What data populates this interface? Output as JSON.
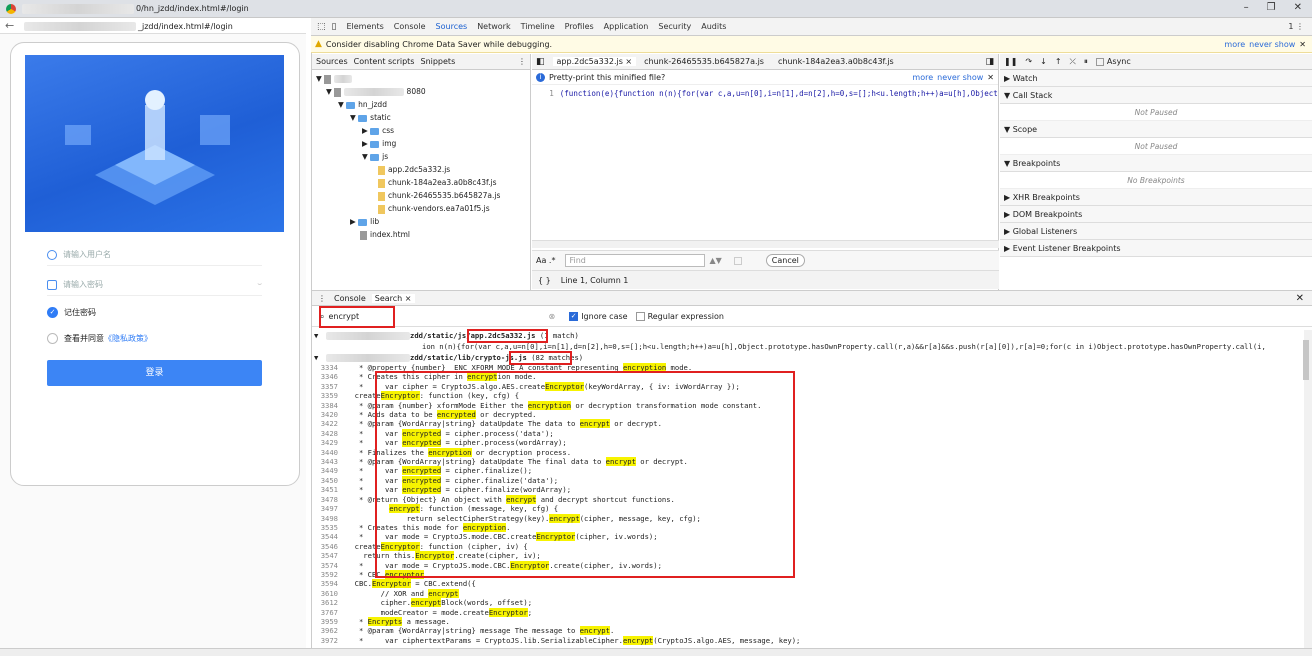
{
  "browser": {
    "title_url": "0/hn_jzdd/index.html#/login",
    "address": "_jzdd/index.html#/login",
    "window_controls": [
      "–",
      "❐",
      "✕"
    ]
  },
  "login_page": {
    "username_placeholder": "请输入用户名",
    "password_placeholder": "请输入密码",
    "remember_label": "记住密码",
    "agree_prefix": "查看并同意",
    "policy_link": "《隐私政策》",
    "login_button": "登录"
  },
  "devtools": {
    "tabs": [
      "Elements",
      "Console",
      "Sources",
      "Network",
      "Timeline",
      "Profiles",
      "Application",
      "Security",
      "Audits"
    ],
    "active_tab": "Sources",
    "warning": "Consider disabling Chrome Data Saver while debugging.",
    "warning_more": "more",
    "warning_never": "never show",
    "nav_tabs": [
      "Sources",
      "Content scripts",
      "Snippets"
    ],
    "tree": {
      "root": "top",
      "host": "8080",
      "project": "hn_jzdd",
      "static": "static",
      "css": "css",
      "img": "img",
      "js": "js",
      "files": [
        "app.2dc5a332.js",
        "chunk-184a2ea3.a0b8c43f.js",
        "chunk-26465535.b645827a.js",
        "chunk-vendors.ea7a01f5.js"
      ],
      "lib": "lib",
      "index": "index.html"
    },
    "editor_tabs": [
      "app.2dc5a332.js ×",
      "chunk-26465535.b645827a.js",
      "chunk-184a2ea3.a0b8c43f.js"
    ],
    "pretty_print": "Pretty-print this minified file?",
    "pretty_more": "more",
    "pretty_never": "never show",
    "code_line_no": "1",
    "code_line": "(function(e){function n(n){for(var c,a,u=n[0],i=n[1],d=n[2],h=0,s=[];h<u.length;h++)a=u[h],Object.",
    "find_placeholder": "Find",
    "cancel": "Cancel",
    "cursor_pos": "Line 1, Column 1",
    "debugger_async": "Async",
    "sections": {
      "watch": "Watch",
      "callstack": "Call Stack",
      "not_paused": "Not Paused",
      "scope": "Scope",
      "not_paused2": "Not Paused",
      "breakpoints": "Breakpoints",
      "no_breakpoints": "No Breakpoints",
      "xhr": "XHR Breakpoints",
      "dom": "DOM Breakpoints",
      "global": "Global Listeners",
      "event": "Event Listener Breakpoints"
    },
    "drawer_tabs": [
      "Console",
      "Search ×"
    ],
    "search_value": "encrypt",
    "ignore_case": "Ignore case",
    "regex": "Regular expression",
    "result1_path": "zdd/static/js/",
    "result1_file": "app.2dc5a332.js",
    "result1_count": "(1 match)",
    "result1_line": "ion n(n){for(var c,a,u=n[0],i=n[1],d=n[2],h=0,s=[];h<u.length;h++)a=u[h],Object.prototype.hasOwnProperty.call(r,a)&&r[a]&&s.push(r[a][0]),r[a]=0;for(c in i)Object.prototype.hasOwnProperty.call(i,",
    "result2_path": "zdd/static/lib/",
    "result2_file": "crypto-js.js",
    "result2_count": "(82 matches)",
    "results": [
      {
        "ln": "3334",
        "pre": "   * @property {number} _ENC_XFORM_MODE A constant representing ",
        "hl": "encryption",
        "post": " mode."
      },
      {
        "ln": "3346",
        "pre": "   * Creates this cipher in ",
        "hl": "encrypt",
        "post": "ion mode."
      },
      {
        "ln": "3357",
        "pre": "   *     var cipher = CryptoJS.algo.AES.create",
        "hl": "Encryptor",
        "post": "(keyWordArray, { iv: ivWordArray });"
      },
      {
        "ln": "3359",
        "pre": "  create",
        "hl": "Encryptor",
        "post": ": function (key, cfg) {"
      },
      {
        "ln": "3384",
        "pre": "   * @param {number} xformMode Either the ",
        "hl": "encryption",
        "post": " or decryption transformation mode constant."
      },
      {
        "ln": "3420",
        "pre": "   * Adds data to be ",
        "hl": "encrypted",
        "post": " or decrypted."
      },
      {
        "ln": "3422",
        "pre": "   * @param {WordArray|string} dataUpdate The data to ",
        "hl": "encrypt",
        "post": " or decrypt."
      },
      {
        "ln": "3428",
        "pre": "   *     var ",
        "hl": "encrypted",
        "post": " = cipher.process('data');"
      },
      {
        "ln": "3429",
        "pre": "   *     var ",
        "hl": "encrypted",
        "post": " = cipher.process(wordArray);"
      },
      {
        "ln": "3440",
        "pre": "   * Finalizes the ",
        "hl": "encryption",
        "post": " or decryption process."
      },
      {
        "ln": "3443",
        "pre": "   * @param {WordArray|string} dataUpdate The final data to ",
        "hl": "encrypt",
        "post": " or decrypt."
      },
      {
        "ln": "3449",
        "pre": "   *     var ",
        "hl": "encrypted",
        "post": " = cipher.finalize();"
      },
      {
        "ln": "3450",
        "pre": "   *     var ",
        "hl": "encrypted",
        "post": " = cipher.finalize('data');"
      },
      {
        "ln": "3451",
        "pre": "   *     var ",
        "hl": "encrypted",
        "post": " = cipher.finalize(wordArray);"
      },
      {
        "ln": "3478",
        "pre": "   * @return {Object} An object with ",
        "hl": "encrypt",
        "post": " and decrypt shortcut functions."
      },
      {
        "ln": "3497",
        "pre": "          ",
        "hl": "encrypt",
        "post": ": function (message, key, cfg) {"
      },
      {
        "ln": "3498",
        "pre": "              return selectCipherStrategy(key).",
        "hl": "encrypt",
        "post": "(cipher, message, key, cfg);"
      },
      {
        "ln": "3535",
        "pre": "   * Creates this mode for ",
        "hl": "encryption",
        "post": "."
      },
      {
        "ln": "3544",
        "pre": "   *     var mode = CryptoJS.mode.CBC.create",
        "hl": "Encryptor",
        "post": "(cipher, iv.words);"
      },
      {
        "ln": "3546",
        "pre": "  create",
        "hl": "Encryptor",
        "post": ": function (cipher, iv) {"
      },
      {
        "ln": "3547",
        "pre": "    return this.",
        "hl": "Encryptor",
        "post": ".create(cipher, iv);"
      },
      {
        "ln": "3574",
        "pre": "   *     var mode = CryptoJS.mode.CBC.",
        "hl": "Encryptor",
        "post": ".create(cipher, iv.words);"
      },
      {
        "ln": "3592",
        "pre": "   * CBC ",
        "hl": "encryptor",
        "post": "."
      },
      {
        "ln": "3594",
        "pre": "  CBC.",
        "hl": "Encryptor",
        "post": " = CBC.extend({"
      },
      {
        "ln": "3610",
        "pre": "        // XOR and ",
        "hl": "encrypt",
        "post": ""
      },
      {
        "ln": "3612",
        "pre": "        cipher.",
        "hl": "encrypt",
        "post": "Block(words, offset);"
      },
      {
        "ln": "3767",
        "pre": "        modeCreator = mode.create",
        "hl": "Encryptor",
        "post": ";"
      },
      {
        "ln": "3959",
        "pre": "   * ",
        "hl": "Encrypts",
        "post": " a message."
      },
      {
        "ln": "3962",
        "pre": "   * @param {WordArray|string} message The message to ",
        "hl": "encrypt",
        "post": "."
      },
      {
        "ln": "3972",
        "pre": "   *     var ciphertextParams = CryptoJS.lib.SerializableCipher.",
        "hl": "encrypt",
        "post": "(CryptoJS.algo.AES, message, key);"
      }
    ]
  }
}
